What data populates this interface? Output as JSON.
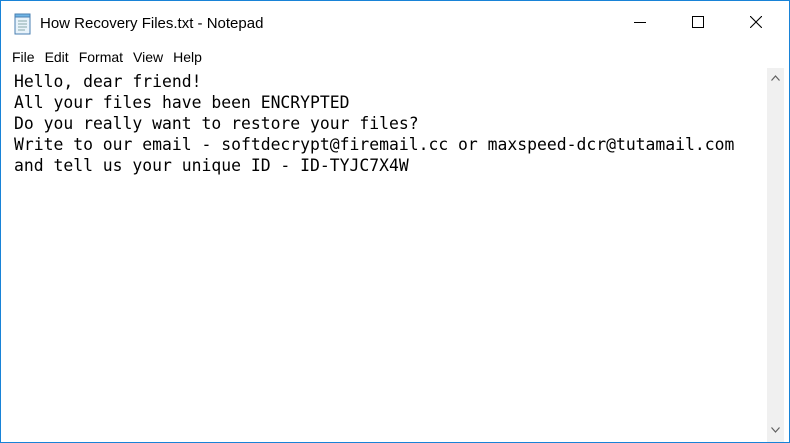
{
  "window": {
    "title": "How Recovery Files.txt - Notepad"
  },
  "title_controls": {
    "minimize_icon": "minimize-icon",
    "maximize_icon": "maximize-icon",
    "close_icon": "close-icon"
  },
  "menubar": {
    "items": [
      "File",
      "Edit",
      "Format",
      "View",
      "Help"
    ]
  },
  "editor": {
    "content": "Hello, dear friend!\nAll your files have been ENCRYPTED\nDo you really want to restore your files?\nWrite to our email - softdecrypt@firemail.cc or maxspeed-dcr@tutamail.com\nand tell us your unique ID - ID-TYJC7X4W"
  },
  "colors": {
    "window_border": "#1883d7",
    "scrollbar_track": "#f0f0f0"
  }
}
